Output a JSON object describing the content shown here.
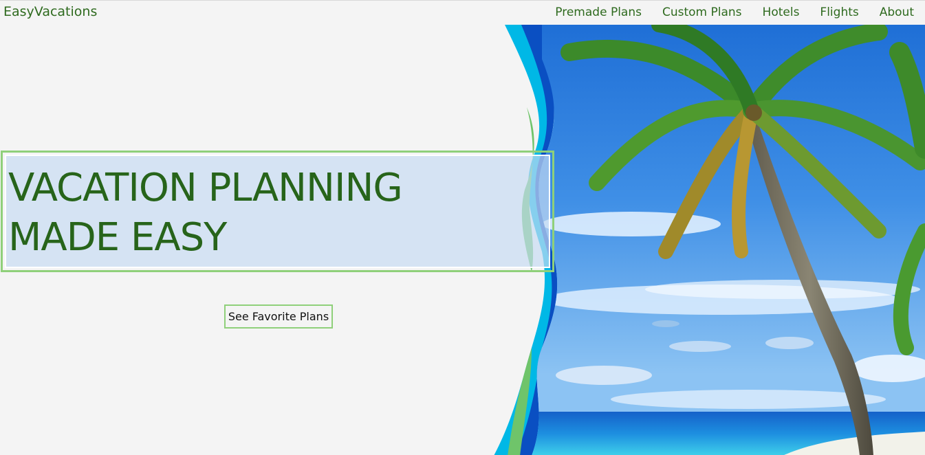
{
  "nav": {
    "brand": "EasyVacations",
    "links": [
      {
        "label": "Premade Plans"
      },
      {
        "label": "Custom Plans"
      },
      {
        "label": "Hotels"
      },
      {
        "label": "Flights"
      },
      {
        "label": "About"
      }
    ]
  },
  "hero": {
    "headline_lines": [
      "VACATION PLANNING",
      "MADE EASY"
    ],
    "cta_label": "See Favorite Plans"
  },
  "colors": {
    "brand_green": "#2e6a1e",
    "border_green": "#8fd07a",
    "page_background": "#f4f4f4",
    "headline_fill": "#c5daf2"
  }
}
